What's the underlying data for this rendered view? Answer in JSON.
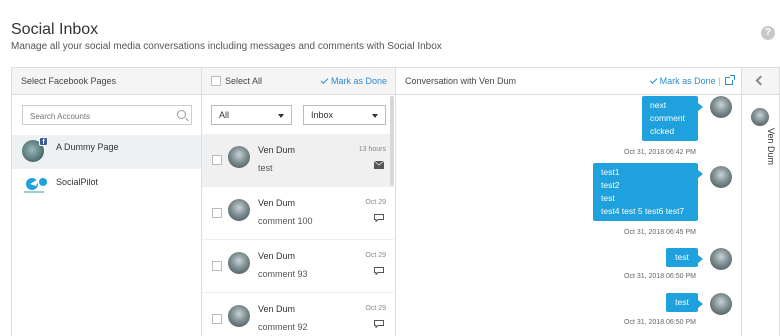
{
  "header": {
    "title": "Social Inbox",
    "subtitle": "Manage all your social media conversations including messages and comments with Social Inbox",
    "help_icon": "?"
  },
  "pages_panel": {
    "title": "Select Facebook Pages",
    "search_placeholder": "Search Accounts",
    "pages": [
      {
        "name": "A Dummy Page",
        "icon": "facebook-badge",
        "active": true
      },
      {
        "name": "SocialPilot",
        "icon": "socialpilot-logo",
        "active": false
      }
    ]
  },
  "list_panel": {
    "select_all": "Select All",
    "mark_done": "Mark as Done",
    "filter_type": "All",
    "filter_folder": "Inbox",
    "items": [
      {
        "from": "Ven Dum",
        "snippet": "test",
        "time": "13 hours",
        "type": "message-icon",
        "active": true
      },
      {
        "from": "Ven Dum",
        "snippet": "comment 100",
        "time": "Oct 29",
        "type": "comment-icon",
        "active": false
      },
      {
        "from": "Ven Dum",
        "snippet": "comment 93",
        "time": "Oct 29",
        "type": "comment-icon",
        "active": false
      },
      {
        "from": "Ven Dum",
        "snippet": "comment 92",
        "time": "Oct 29",
        "type": "comment-icon",
        "active": false
      }
    ]
  },
  "conversation": {
    "title": "Conversation with Ven Dum",
    "mark_done": "Mark as Done",
    "separator": "|",
    "messages": [
      {
        "lines": [
          "next",
          "comment",
          "clcked"
        ],
        "time": "Oct 31, 2018 06:42 PM"
      },
      {
        "lines": [
          "test1",
          "test2",
          "test",
          "test4 test 5 test6 test7"
        ],
        "time": "Oct 31, 2018 06:45 PM"
      },
      {
        "lines": [
          "test"
        ],
        "time": "Oct 31, 2018 06:50 PM"
      },
      {
        "lines": [
          "test"
        ],
        "time": "Oct 31, 2018 06:50 PM"
      }
    ]
  },
  "profile": {
    "name": "Ven Dum"
  },
  "colors": {
    "accent": "#2a8bd5",
    "bubble": "#1ea1dc",
    "facebook": "#3b5998"
  }
}
